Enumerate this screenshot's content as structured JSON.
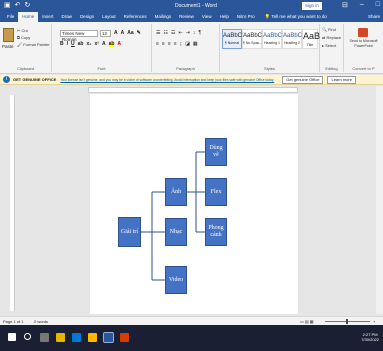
{
  "window": {
    "doc_title": "Document1 - Word",
    "sign_in": "Sign in",
    "share": "Share"
  },
  "tabs": [
    "File",
    "Home",
    "Insert",
    "Draw",
    "Design",
    "Layout",
    "References",
    "Mailings",
    "Review",
    "View",
    "Help",
    "Nitro Pro"
  ],
  "tell_me": "Tell me what you want to do",
  "ribbon": {
    "clipboard": {
      "paste": "Paste",
      "cut": "Cut",
      "copy": "Copy",
      "format_painter": "Format Painter",
      "label": "Clipboard"
    },
    "font": {
      "name": "Times New Roman",
      "size": "12",
      "label": "Font"
    },
    "paragraph": {
      "label": "Paragraph"
    },
    "styles": {
      "items": [
        {
          "preview": "AaBbCcI",
          "name": "¶ Normal"
        },
        {
          "preview": "AaBbCcI",
          "name": "¶ No Spac..."
        },
        {
          "preview": "AaBbC",
          "name": "Heading 1"
        },
        {
          "preview": "AaBbCcE",
          "name": "Heading 2"
        },
        {
          "preview": "AaB",
          "name": "Title"
        }
      ],
      "label": "Styles"
    },
    "editing": {
      "find": "Find",
      "replace": "Replace",
      "select": "Select",
      "label": "Editing"
    },
    "convert": {
      "send": "Send to Microsoft PowerPoint",
      "label": "Convert to P"
    }
  },
  "warning": {
    "title": "GET GENUINE OFFICE",
    "message": "Your license isn't genuine, and you may be a victim of software counterfeiting. Avoid interruption and keep your files safe with genuine Office today.",
    "btn_get": "Get genuine Office",
    "btn_learn": "Learn more"
  },
  "diagram": {
    "root": "Giải trí",
    "level1": [
      "Ảnh",
      "Nhạc",
      "Video"
    ],
    "level2": [
      "Dùng vẽ",
      "Flex",
      "Phong cảnh"
    ]
  },
  "status": {
    "page": "Page 1 of 1",
    "words": "0 words",
    "zoom": "+"
  },
  "tray": {
    "time": "2:27 PM",
    "date": "7/30/2022"
  }
}
